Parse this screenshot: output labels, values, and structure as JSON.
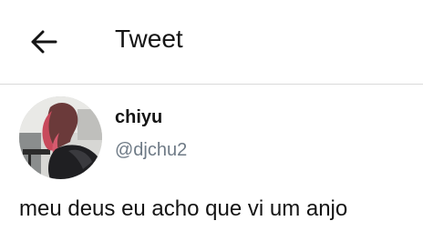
{
  "header": {
    "title": "Tweet",
    "back_icon": "arrow-left-icon"
  },
  "tweet": {
    "author_name": "chiyu",
    "author_handle": "@djchu2",
    "text": "meu deus eu acho que vi um anjo",
    "avatar_icon": "profile-photo"
  },
  "colors": {
    "text_primary": "#141414",
    "text_secondary": "#6e7a86",
    "divider": "#d9d9d9",
    "background": "#ffffff"
  }
}
